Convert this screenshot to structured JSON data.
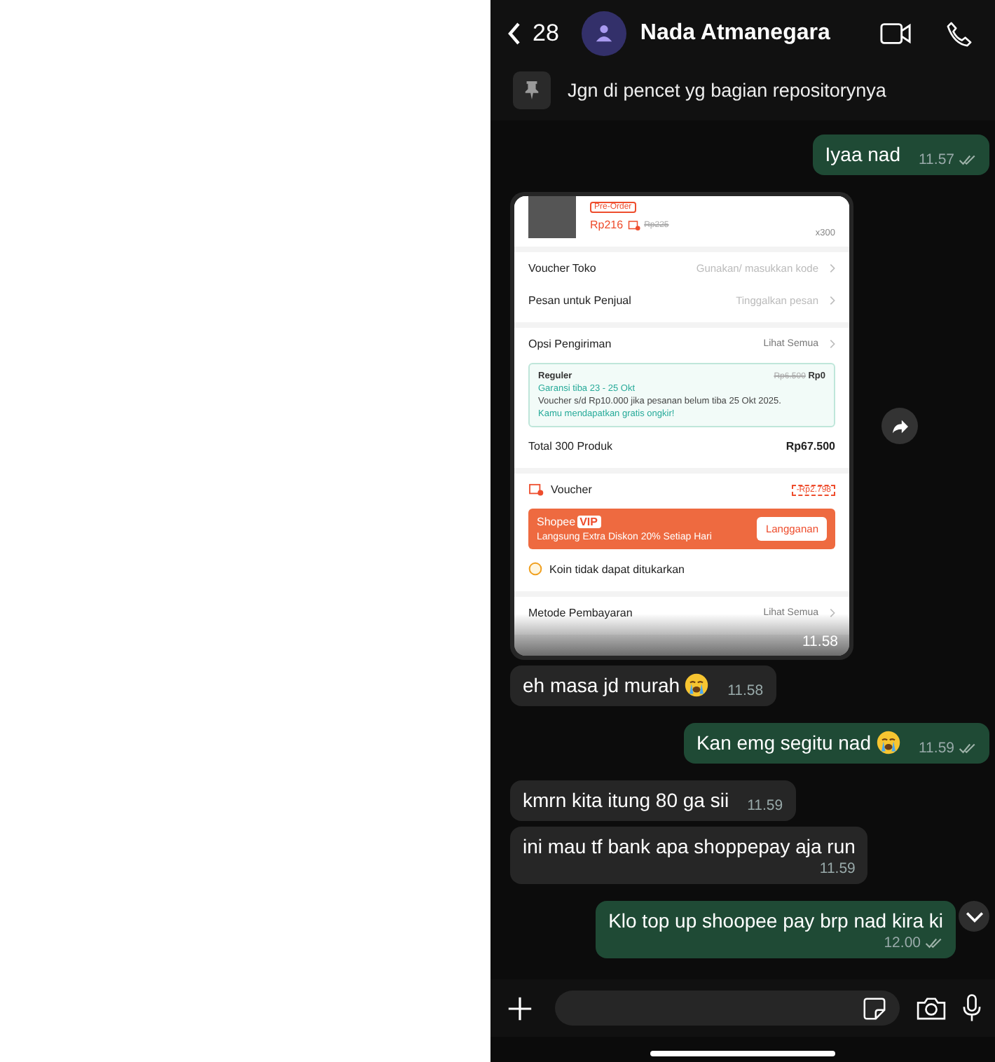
{
  "header": {
    "back_count": "28",
    "contact_name": "Nada Atmanegara"
  },
  "pinned": {
    "text": "Jgn di pencet yg bagian repositorynya"
  },
  "messages": [
    {
      "kind": "text",
      "outgoing": true,
      "text": "Iyaa nad",
      "time": "11.57",
      "read": true
    },
    {
      "kind": "image",
      "outgoing": false,
      "time": "11.58",
      "shot": {
        "product": {
          "badge": "Pre-Order",
          "price": "Rp216",
          "old_price": "Rp225",
          "quantity": "x300"
        },
        "rows": [
          {
            "label": "Voucher Toko",
            "value": "Gunakan/ masukkan kode"
          },
          {
            "label": "Pesan untuk Penjual",
            "value": "Tinggalkan pesan"
          }
        ],
        "shipping": {
          "label": "Opsi Pengiriman",
          "link": "Lihat Semua",
          "service": "Reguler",
          "old_fee": "Rp6.500",
          "fee": "Rp0",
          "guarantee": "Garansi tiba 23 - 25 Okt",
          "note": "Voucher s/d  Rp10.000 jika pesanan belum tiba 25 Okt 2025.",
          "free": "Kamu mendapatkan gratis ongkir!"
        },
        "total": {
          "label": "Total 300 Produk",
          "value": "Rp67.500"
        },
        "voucher": {
          "label": "Voucher",
          "value": "-Rp2.798"
        },
        "vip": {
          "brand": "Shopee",
          "tag": "VIP",
          "text": "Langsung Extra Diskon 20% Setiap Hari",
          "button": "Langganan"
        },
        "coins": {
          "text": "Koin tidak dapat ditukarkan"
        },
        "payment": {
          "label": "Metode Pembayaran",
          "link": "Lihat Semua"
        }
      }
    },
    {
      "kind": "text",
      "outgoing": false,
      "text": "eh masa jd murah",
      "emoji_icon": true,
      "time": "11.58"
    },
    {
      "kind": "text",
      "outgoing": true,
      "text": "Kan emg segitu nad ",
      "emoji_icon": true,
      "time": "11.59",
      "read": true
    },
    {
      "kind": "text",
      "outgoing": false,
      "text": "kmrn kita itung 80 ga sii",
      "time": "11.59"
    },
    {
      "kind": "text",
      "outgoing": false,
      "text": "ini mau tf bank apa shoppepay aja run",
      "time": "11.59",
      "wrap_time": true
    },
    {
      "kind": "text",
      "outgoing": true,
      "text": "Klo top up shoopee pay brp nad kira ki",
      "time": "12.00",
      "read": true,
      "wrap_time": true
    }
  ]
}
